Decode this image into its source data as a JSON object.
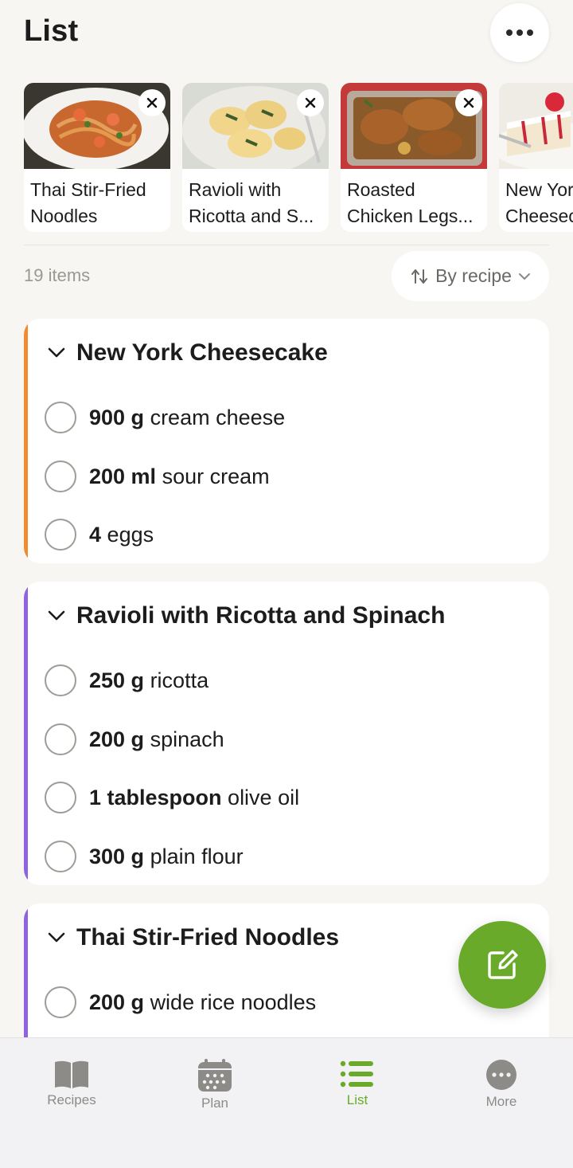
{
  "header": {
    "title": "List"
  },
  "recipes": [
    {
      "name": "Thai Stir-Fried Noodles"
    },
    {
      "name": "Ravioli with Ricotta and S..."
    },
    {
      "name": "Roasted Chicken Legs..."
    },
    {
      "name": "New York Cheesecake"
    }
  ],
  "summary": {
    "count": "19 items",
    "sort_label": "By recipe"
  },
  "groups": [
    {
      "title": "New York Cheesecake",
      "accent": "#f28a2e",
      "items": [
        {
          "qty": "900 g",
          "name": "cream cheese"
        },
        {
          "qty": "200 ml",
          "name": "sour cream"
        },
        {
          "qty": "4",
          "name": "eggs"
        }
      ]
    },
    {
      "title": "Ravioli with Ricotta and Spinach",
      "accent": "#8e63e0",
      "items": [
        {
          "qty": "250 g",
          "name": "ricotta"
        },
        {
          "qty": "200 g",
          "name": "spinach"
        },
        {
          "qty": "1 tablespoon",
          "name": "olive oil"
        },
        {
          "qty": "300 g",
          "name": "plain flour"
        }
      ]
    },
    {
      "title": "Thai Stir-Fried Noodles",
      "accent": "#8e63e0",
      "items": [
        {
          "qty": "200 g",
          "name": "wide rice noodles"
        }
      ]
    }
  ],
  "tabs": [
    {
      "label": "Recipes",
      "icon": "book-icon"
    },
    {
      "label": "Plan",
      "icon": "calendar-icon"
    },
    {
      "label": "List",
      "icon": "list-icon"
    },
    {
      "label": "More",
      "icon": "more-icon"
    }
  ],
  "colors": {
    "accent_green": "#6aaa2b",
    "background": "#f7f6f3"
  }
}
